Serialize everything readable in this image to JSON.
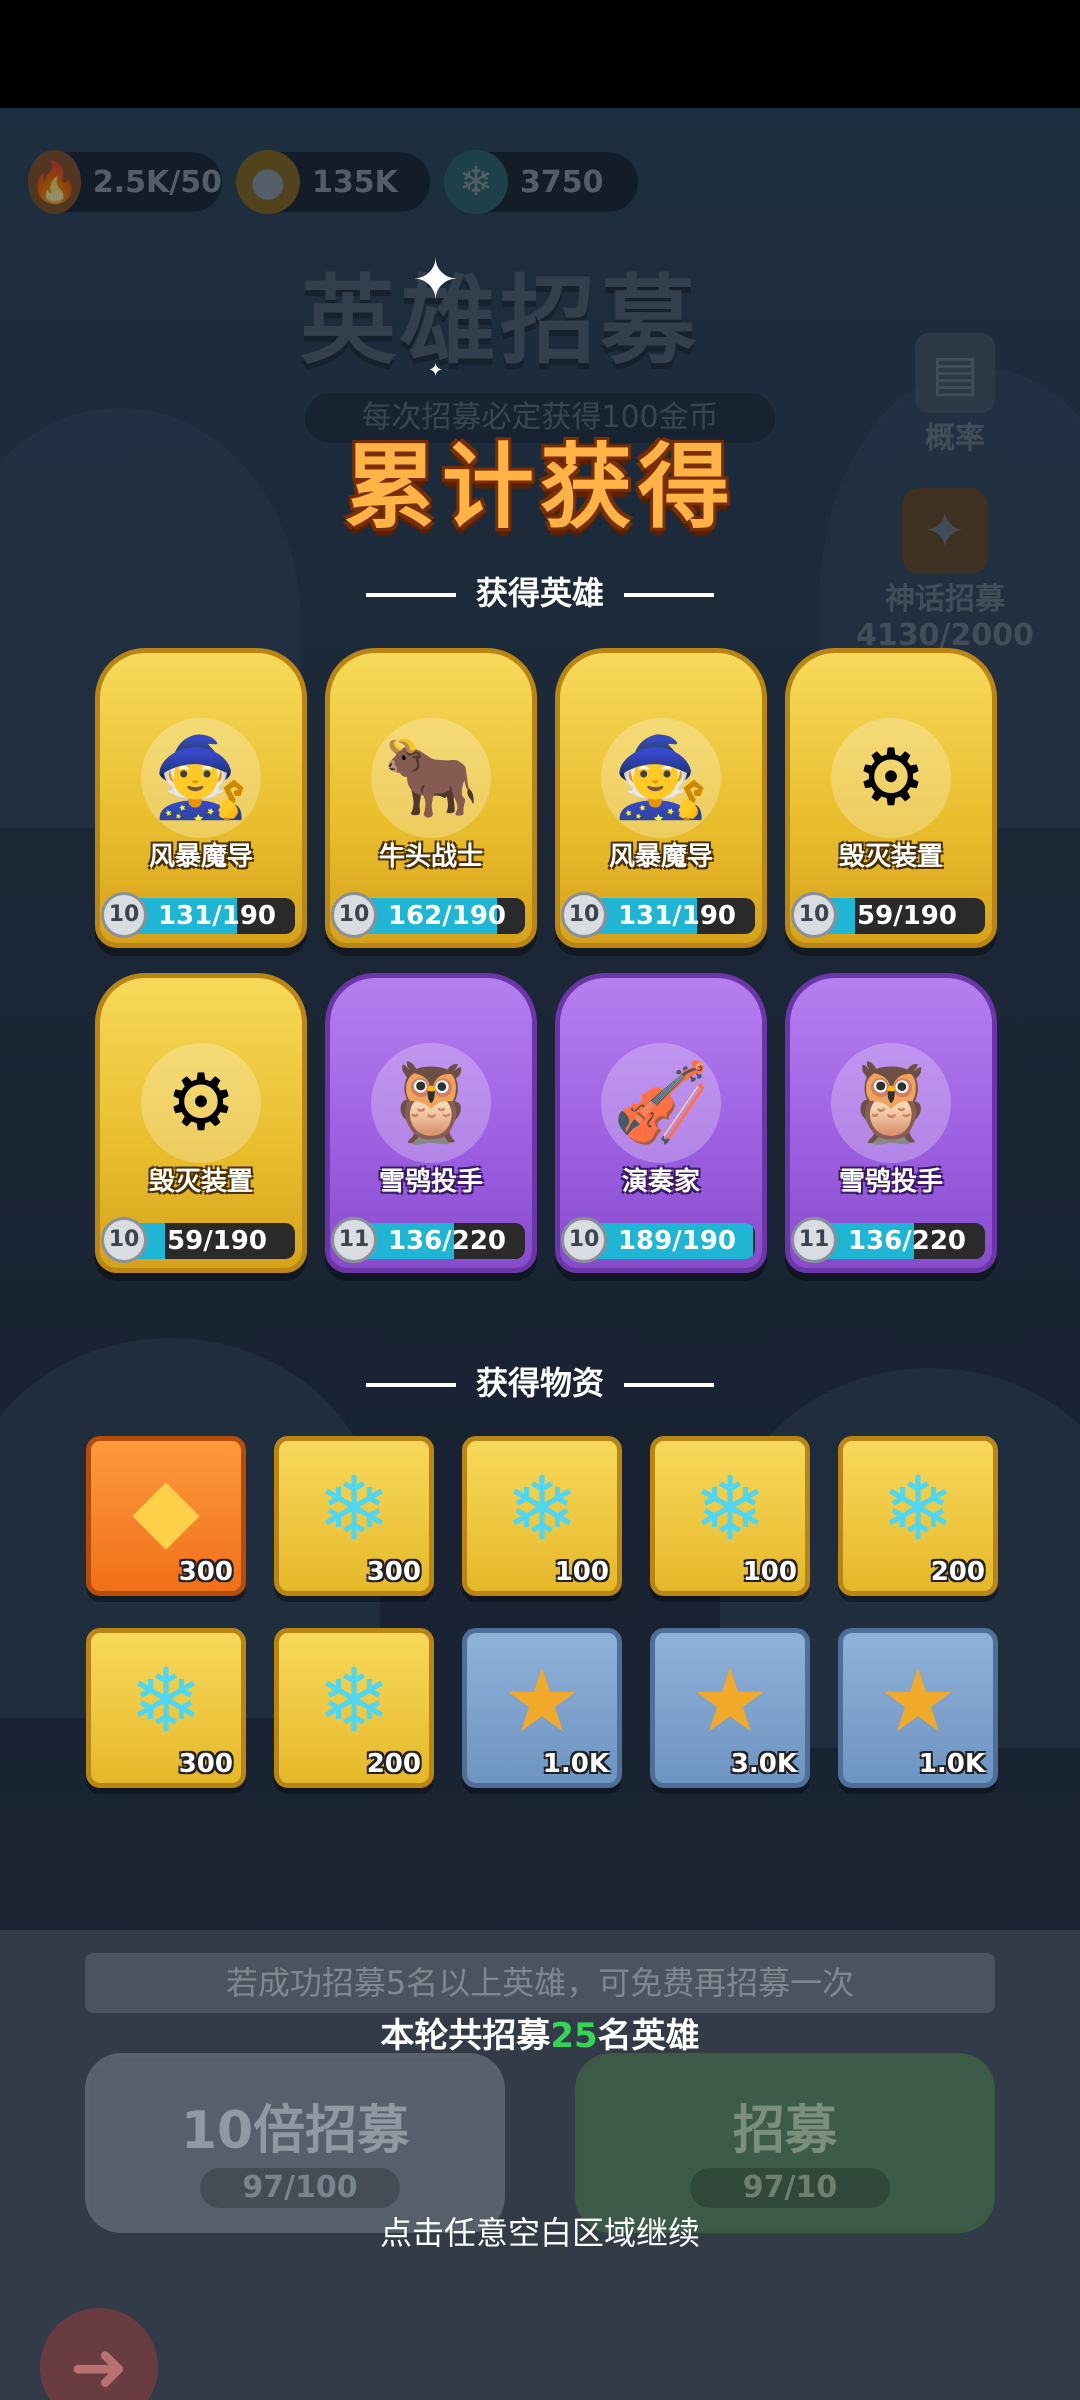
{
  "top_bar": {
    "energy_value": "2.5K/50",
    "gold_value": "135K",
    "crystal_value": "3750"
  },
  "background": {
    "title": "英雄招募",
    "subtitle": "每次招募必定获得100金币",
    "rate_label": "概率",
    "mythic_label": "神话招募",
    "mythic_progress": "4130/2000"
  },
  "overlay": {
    "title": "累计获得",
    "heroes_section": "获得英雄",
    "items_section": "获得物资"
  },
  "heroes": [
    {
      "name": "风暴魔导",
      "level": "10",
      "count": "131/190",
      "progress": 0.69,
      "rarity": "gold",
      "icon": "wizard"
    },
    {
      "name": "牛头战士",
      "level": "10",
      "count": "162/190",
      "progress": 0.85,
      "rarity": "gold",
      "icon": "minotaur"
    },
    {
      "name": "风暴魔导",
      "level": "10",
      "count": "131/190",
      "progress": 0.69,
      "rarity": "gold",
      "icon": "wizard"
    },
    {
      "name": "毁灭装置",
      "level": "10",
      "count": "59/190",
      "progress": 0.31,
      "rarity": "gold",
      "icon": "cannon"
    },
    {
      "name": "毁灭装置",
      "level": "10",
      "count": "59/190",
      "progress": 0.31,
      "rarity": "gold",
      "icon": "cannon"
    },
    {
      "name": "雪鸮投手",
      "level": "11",
      "count": "136/220",
      "progress": 0.62,
      "rarity": "purple",
      "icon": "owl"
    },
    {
      "name": "演奏家",
      "level": "10",
      "count": "189/190",
      "progress": 0.99,
      "rarity": "purple",
      "icon": "bard"
    },
    {
      "name": "雪鸮投手",
      "level": "11",
      "count": "136/220",
      "progress": 0.62,
      "rarity": "purple",
      "icon": "owl"
    }
  ],
  "items": [
    {
      "type": "gem",
      "qty": "300",
      "frame": "orange"
    },
    {
      "type": "crystal",
      "qty": "300",
      "frame": "yellow"
    },
    {
      "type": "crystal",
      "qty": "100",
      "frame": "yellow"
    },
    {
      "type": "crystal",
      "qty": "100",
      "frame": "yellow"
    },
    {
      "type": "crystal",
      "qty": "200",
      "frame": "yellow"
    },
    {
      "type": "crystal",
      "qty": "300",
      "frame": "yellow"
    },
    {
      "type": "crystal",
      "qty": "200",
      "frame": "yellow"
    },
    {
      "type": "coin",
      "qty": "1.0K",
      "frame": "blue"
    },
    {
      "type": "coin",
      "qty": "3.0K",
      "frame": "blue"
    },
    {
      "type": "coin",
      "qty": "1.0K",
      "frame": "blue"
    }
  ],
  "bottom": {
    "hint": "若成功招募5名以上英雄，可免费再招募一次",
    "summary_prefix": "本轮共招募",
    "summary_count": "25",
    "summary_suffix": "名英雄",
    "ten_recruit_label": "10倍招募",
    "ten_recruit_cost": "97/100",
    "recruit_label": "招募",
    "recruit_cost": "97/10",
    "continue_text": "点击任意空白区域继续"
  },
  "colors": {
    "title_orange": "#ffb347",
    "highlight_green": "#36d455",
    "progress_cyan": "#1fb6d6"
  }
}
